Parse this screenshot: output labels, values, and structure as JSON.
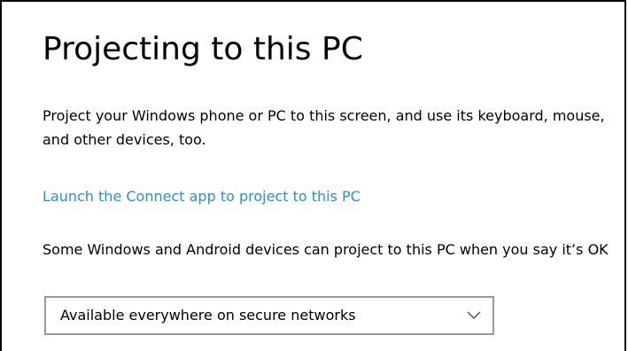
{
  "page": {
    "title": "Projecting to this PC",
    "description": "Project your Windows phone or PC to this screen, and use its keyboard, mouse, and other devices, too.",
    "connect_link": "Launch the Connect app to project to this PC",
    "permission_text": "Some Windows and Android devices can project to this PC when you say it’s OK",
    "availability_dropdown": {
      "selected": "Available everywhere on secure networks",
      "icon": "chevron-down-icon"
    }
  },
  "colors": {
    "link": "#2a8fd0",
    "text": "#000000",
    "dropdown_border": "#999999",
    "background": "#ffffff"
  }
}
